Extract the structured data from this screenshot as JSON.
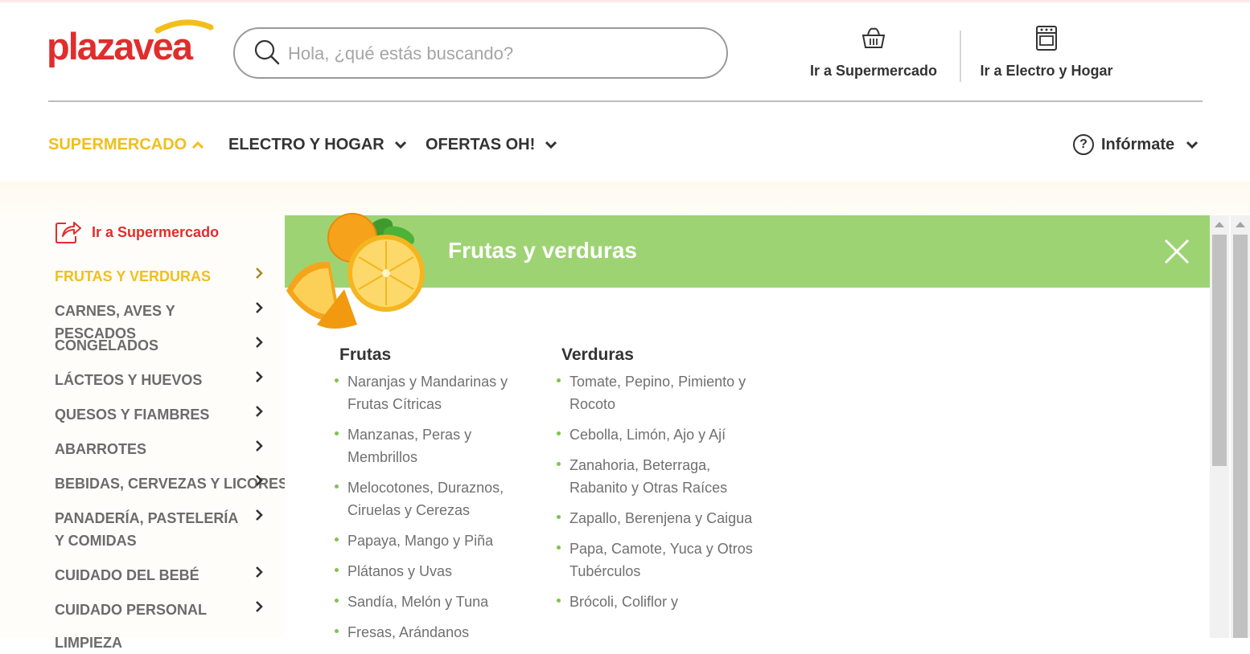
{
  "header": {
    "logo_text": "plazavea",
    "search_placeholder": "Hola, ¿qué estás buscando?",
    "links": [
      {
        "label": "Ir a Supermercado",
        "icon": "basket-icon"
      },
      {
        "label": "Ir a Electro y Hogar",
        "icon": "stove-icon"
      }
    ]
  },
  "nav": {
    "items": [
      {
        "label": "SUPERMERCADO",
        "active": true
      },
      {
        "label": "ELECTRO Y HOGAR"
      },
      {
        "label": "OFERTAS OH!"
      }
    ],
    "info_label": "Infórmate"
  },
  "sidebar": {
    "goto_label": "Ir a Supermercado",
    "categories": [
      {
        "label": "FRUTAS Y VERDURAS",
        "active": true
      },
      {
        "label": "CARNES, AVES Y PESCADOS"
      },
      {
        "label": "CONGELADOS"
      },
      {
        "label": "LÁCTEOS Y HUEVOS"
      },
      {
        "label": "QUESOS Y FIAMBRES"
      },
      {
        "label": "ABARROTES"
      },
      {
        "label": "BEBIDAS, CERVEZAS Y LICORES"
      },
      {
        "label": "PANADERÍA, PASTELERÍA Y COMIDAS"
      },
      {
        "label": "CUIDADO DEL BEBÉ"
      },
      {
        "label": "CUIDADO PERSONAL"
      },
      {
        "label": "LIMPIEZA"
      }
    ]
  },
  "panel": {
    "title": "Frutas y verduras",
    "columns": [
      {
        "heading": "Frutas",
        "items": [
          "Naranjas y Mandarinas y Frutas Cítricas",
          "Manzanas, Peras y Membrillos",
          "Melocotones, Duraznos, Ciruelas y Cerezas",
          "Papaya, Mango y Piña",
          "Plátanos y Uvas",
          "Sandía, Melón y Tuna",
          "Fresas, Arándanos"
        ]
      },
      {
        "heading": "Verduras",
        "items": [
          "Tomate, Pepino, Pimiento y Rocoto",
          "Cebolla, Limón, Ajo y Ají",
          "Zanahoria, Beterraga, Rabanito y Otras Raíces",
          "Zapallo, Berenjena y Caigua",
          "Papa, Camote, Yuca y Otros Tubérculos",
          "Brócoli, Coliflor y"
        ]
      }
    ]
  },
  "colors": {
    "brand_red": "#e02d2d",
    "brand_yellow": "#f2be1a",
    "panel_green": "#9ed374",
    "bullet_green": "#7ec351"
  }
}
